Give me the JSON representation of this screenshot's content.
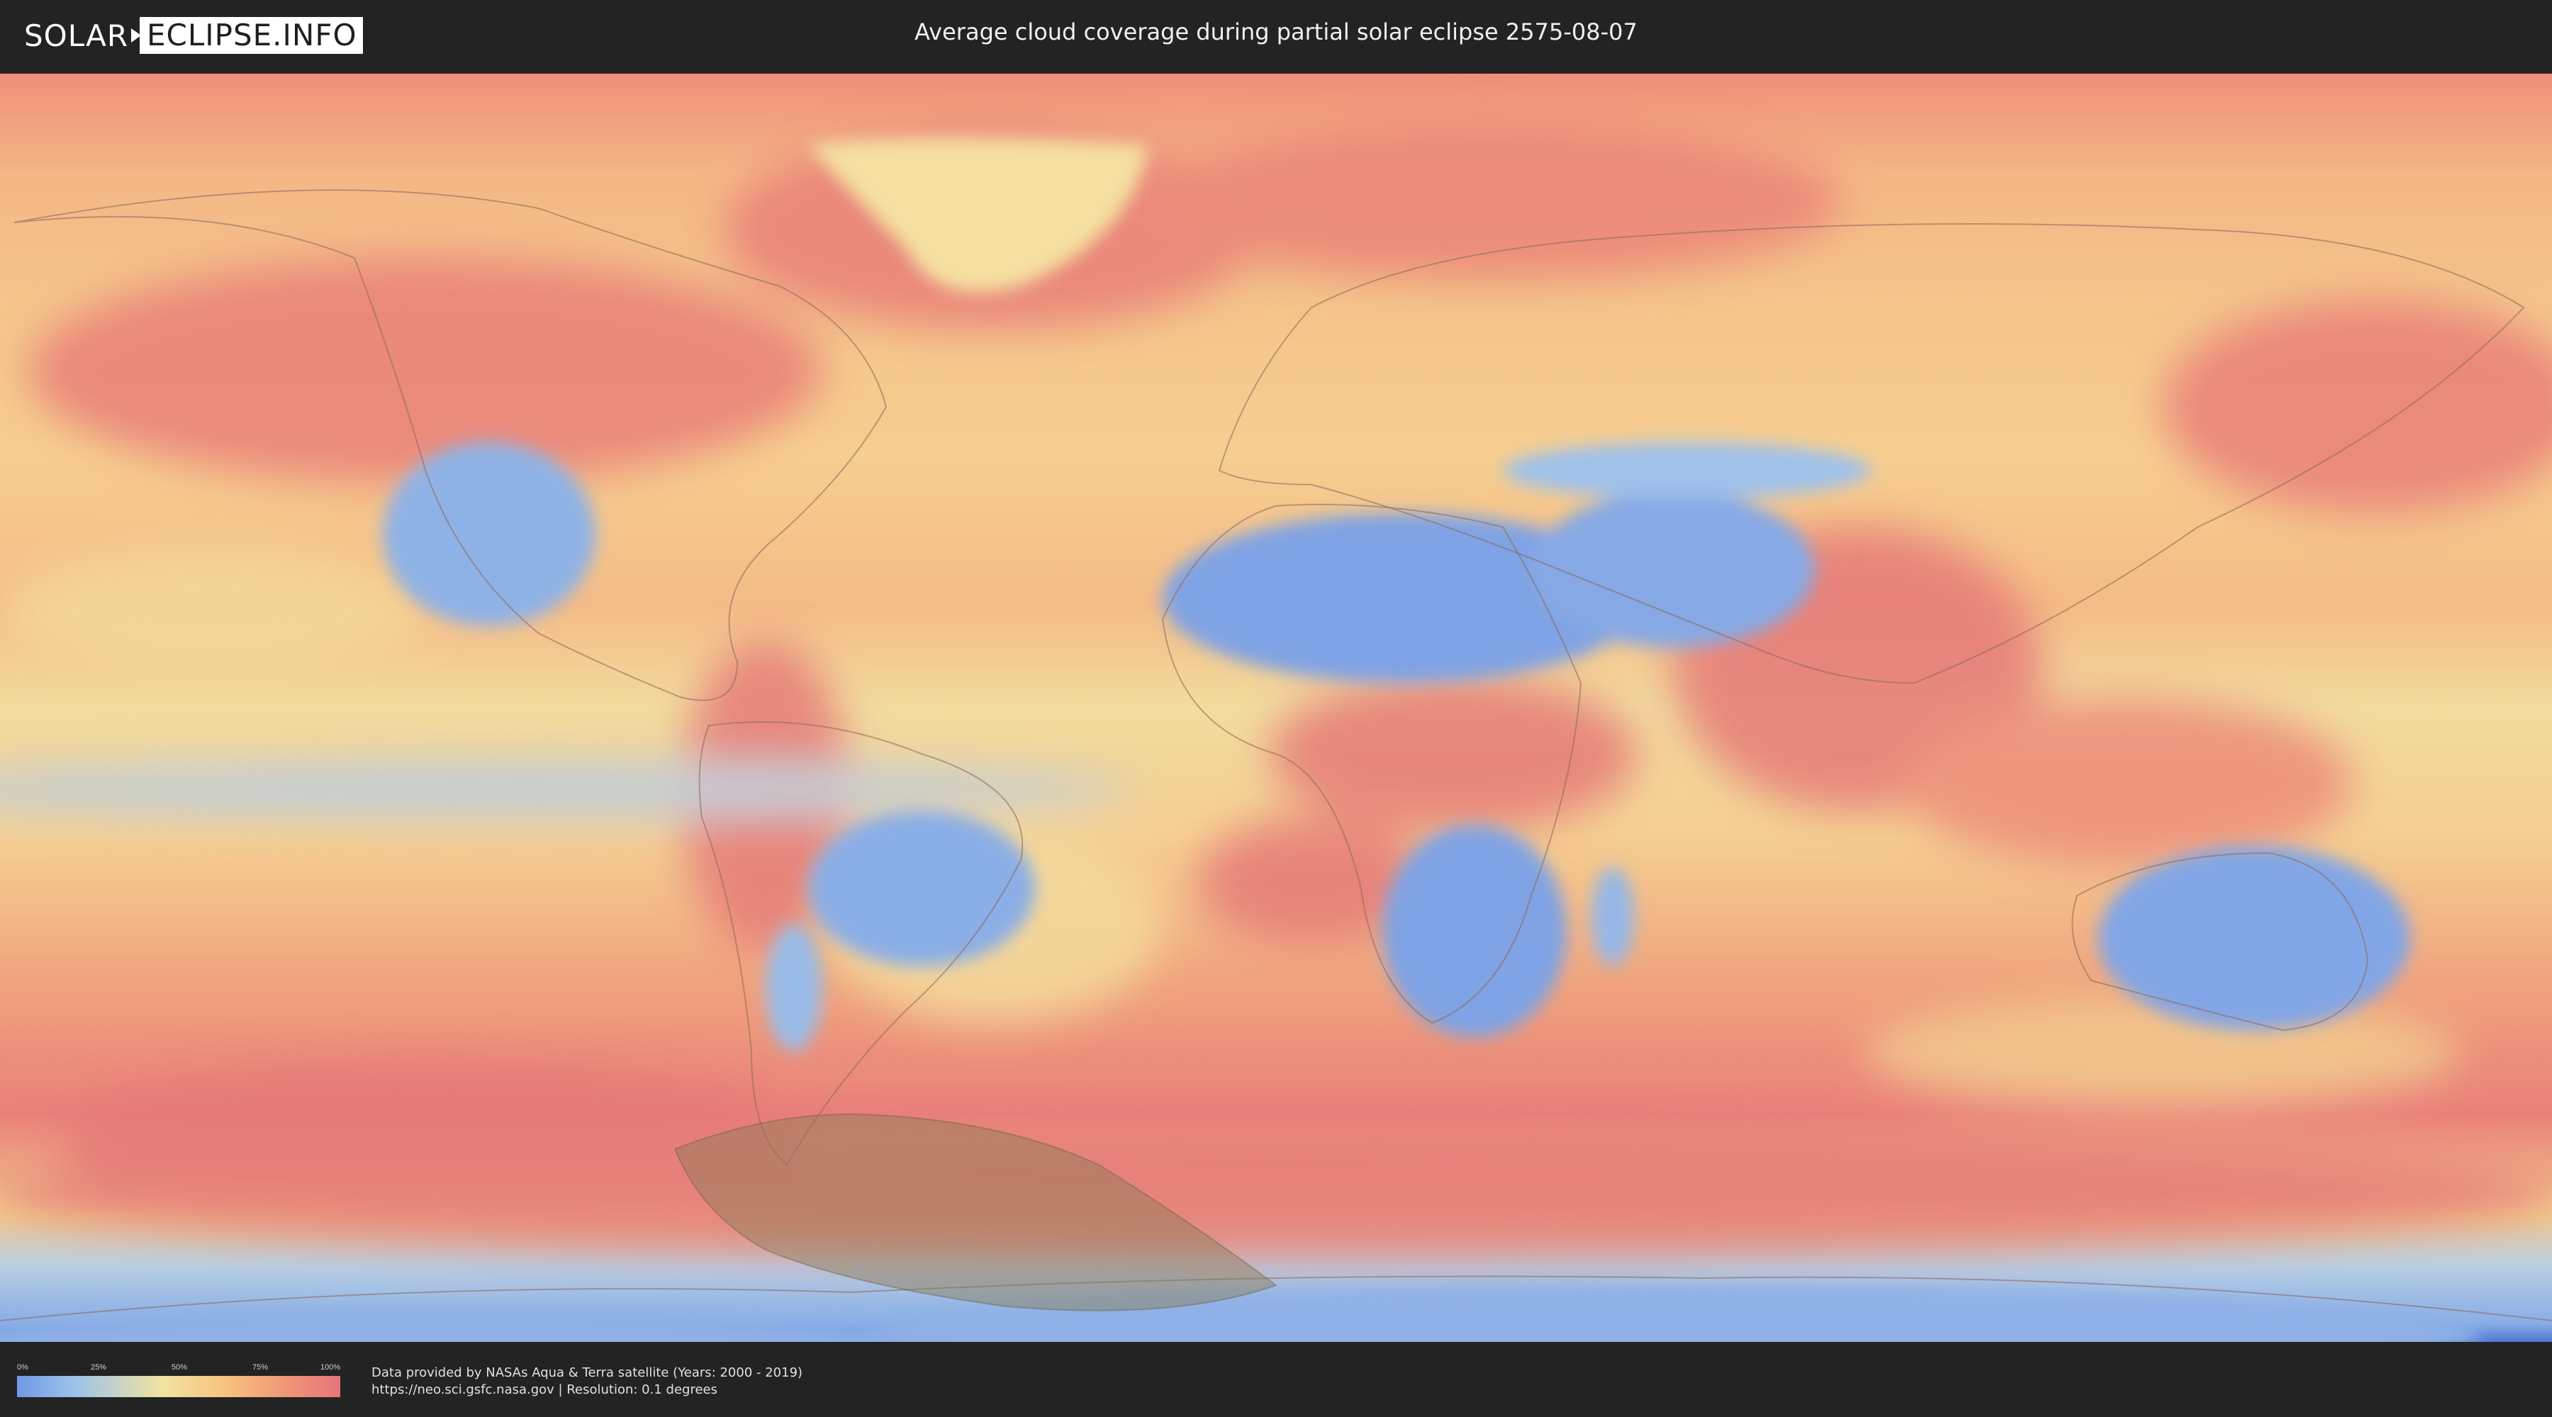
{
  "header": {
    "logo_left": "SOLAR",
    "logo_right": "ECLIPSE.INFO",
    "title": "Average cloud coverage during partial solar eclipse 2575-08-07"
  },
  "map": {
    "projection": "equirectangular",
    "layer": "cloud coverage",
    "eclipse_zone_color": "#8a7a55"
  },
  "legend": {
    "ticks": [
      "0%",
      "25%",
      "50%",
      "75%",
      "100%"
    ],
    "colors": [
      "#6f98e6",
      "#9dc3ea",
      "#f2e3a0",
      "#f6c27e",
      "#ef9276",
      "#e5767a"
    ]
  },
  "credits": {
    "line1": "Data provided by NASAs Aqua & Terra satellite (Years: 2000 - 2019)",
    "line2": "https://neo.sci.gsfc.nasa.gov | Resolution: 0.1 degrees"
  }
}
